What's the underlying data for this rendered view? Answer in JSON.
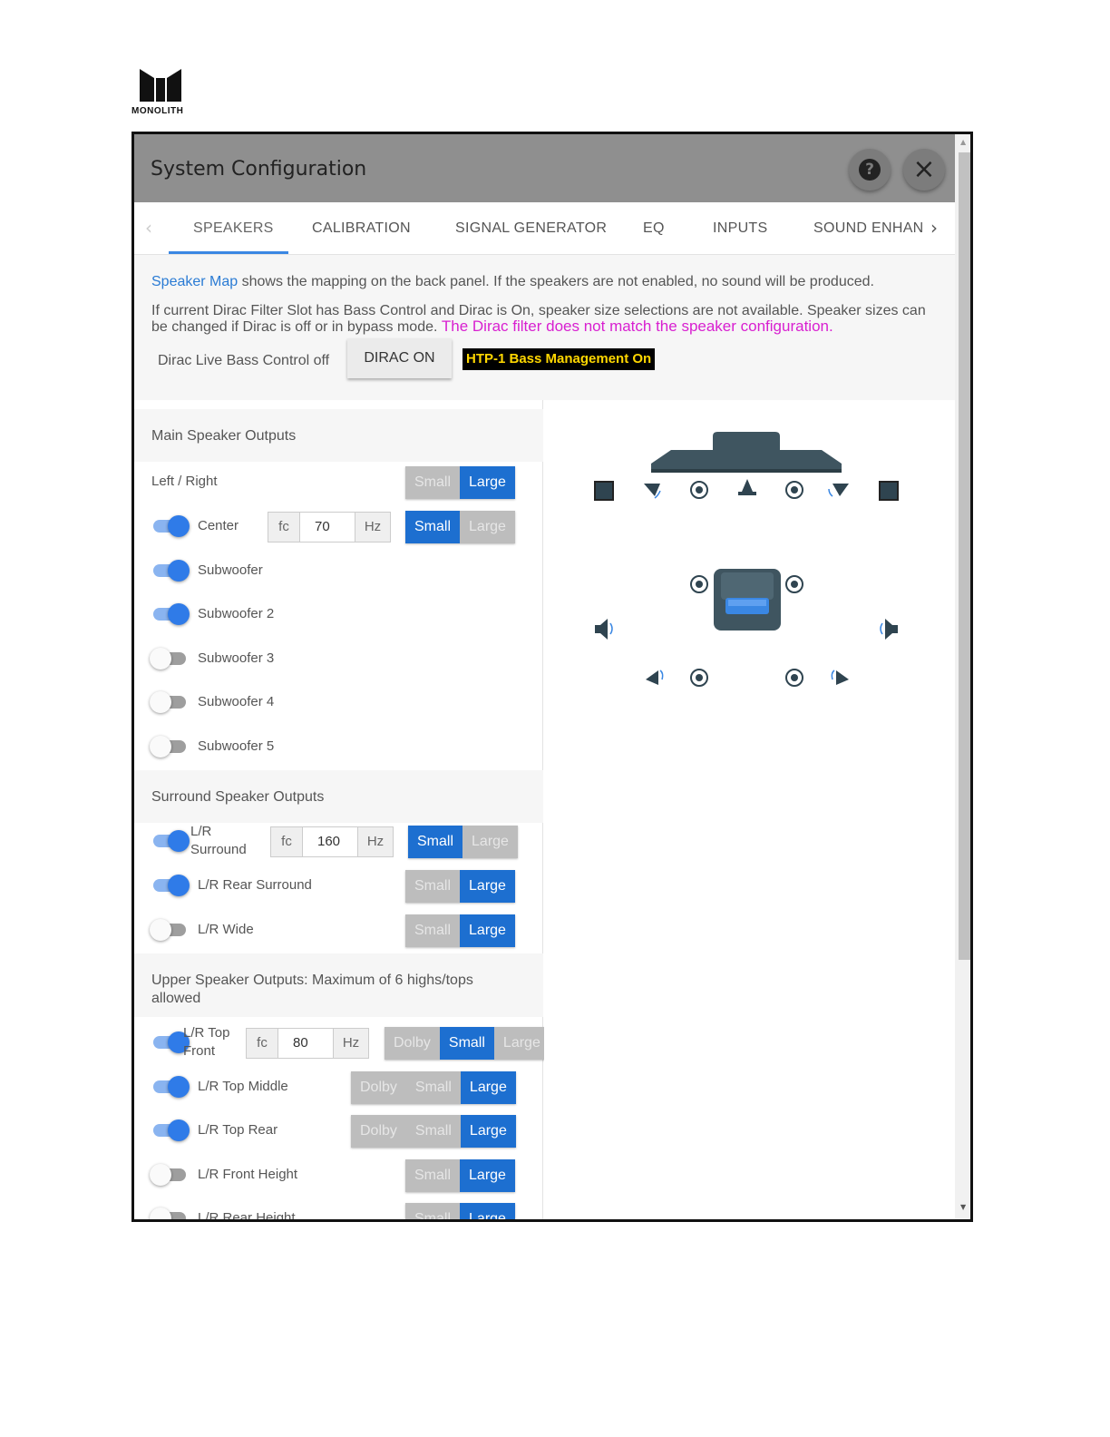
{
  "brand": {
    "logo_text": "MONOLITH"
  },
  "window": {
    "title": "System Configuration"
  },
  "tabs": [
    {
      "label": "SPEAKERS"
    },
    {
      "label": "CALIBRATION"
    },
    {
      "label": "SIGNAL GENERATOR"
    },
    {
      "label": "EQ"
    },
    {
      "label": "INPUTS"
    },
    {
      "label": "SOUND ENHAN"
    }
  ],
  "info": {
    "speaker_map_link": "Speaker Map",
    "line1_rest": " shows the mapping on the back panel. If the speakers are not enabled, no sound will be produced.",
    "line2": "If current Dirac Filter Slot has Bass Control and Dirac is On, speaker size selections are not available. Speaker sizes can be changed if Dirac is off or in bypass mode. ",
    "warning": "The Dirac filter does not match the speaker configuration.",
    "dirac_bass_label": "Dirac Live Bass Control off",
    "dirac_button": "DIRAC ON",
    "bass_mgmt_badge": "HTP-1 Bass Management On"
  },
  "sections": {
    "main": "Main Speaker Outputs",
    "surround": "Surround Speaker Outputs",
    "upper": "Upper Speaker Outputs: Maximum of 6 highs/tops allowed"
  },
  "labels": {
    "fc": "fc",
    "hz": "Hz",
    "small": "Small",
    "large": "Large",
    "dolby": "Dolby"
  },
  "speakers": {
    "left_right": {
      "label": "Left / Right",
      "size": "Large"
    },
    "center": {
      "label": "Center",
      "enabled": true,
      "fc": "70",
      "size": "Small"
    },
    "sub1": {
      "label": "Subwoofer",
      "enabled": true
    },
    "sub2": {
      "label": "Subwoofer 2",
      "enabled": true
    },
    "sub3": {
      "label": "Subwoofer 3",
      "enabled": false
    },
    "sub4": {
      "label": "Subwoofer 4",
      "enabled": false
    },
    "sub5": {
      "label": "Subwoofer 5",
      "enabled": false
    },
    "lr_surround": {
      "label_line1": "L/R",
      "label_line2": "Surround",
      "enabled": true,
      "fc": "160",
      "size": "Small"
    },
    "lr_rear_surround": {
      "label": "L/R Rear Surround",
      "enabled": true,
      "size": "Large"
    },
    "lr_wide": {
      "label": "L/R Wide",
      "enabled": false,
      "size": "Large"
    },
    "lr_top_front": {
      "label_line1": "L/R Top",
      "label_line2": "Front",
      "enabled": true,
      "fc": "80",
      "size": "Small"
    },
    "lr_top_middle": {
      "label": "L/R Top Middle",
      "enabled": true,
      "size": "Large"
    },
    "lr_top_rear": {
      "label": "L/R Top Rear",
      "enabled": true,
      "size": "Large"
    },
    "lr_front_height": {
      "label": "L/R Front Height",
      "enabled": false,
      "size": "Large"
    },
    "lr_rear_height": {
      "label": "L/R Rear Height",
      "enabled": false,
      "size": "Large"
    }
  },
  "colors": {
    "accent": "#1d6fd0",
    "warning": "#d81fd0",
    "link": "#2a7bd4",
    "badge_bg": "#000000",
    "badge_text": "#ffd700"
  },
  "icons": [
    "help-icon",
    "close-icon",
    "chevron-left-icon",
    "chevron-right-icon",
    "speaker-icon",
    "tv-icon",
    "chair-icon"
  ]
}
